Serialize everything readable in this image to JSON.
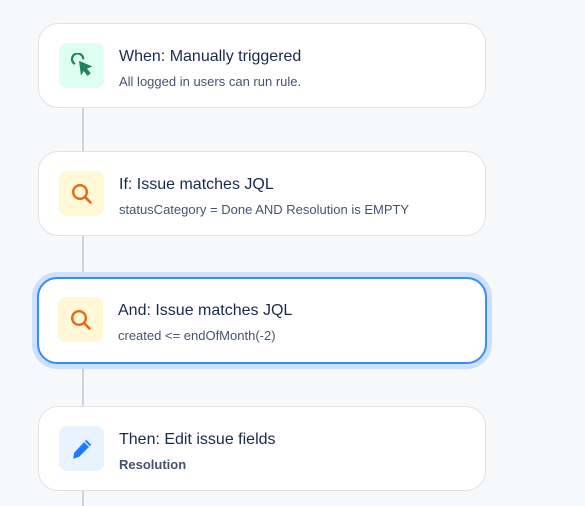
{
  "rule_steps": [
    {
      "title": "When: Manually triggered",
      "subtitle": "All logged in users can run rule.",
      "icon": "cursor-click-icon",
      "icon_color": "#1f845a"
    },
    {
      "title": "If: Issue matches JQL",
      "subtitle": "statusCategory = Done AND Resolution is EMPTY",
      "icon": "search-icon",
      "icon_color": "#e56910"
    },
    {
      "title": "And: Issue matches JQL",
      "subtitle": "created <= endOfMonth(-2)",
      "icon": "search-icon",
      "icon_color": "#e56910",
      "selected": true
    },
    {
      "title": "Then: Edit issue fields",
      "subtitle": "Resolution",
      "icon": "pencil-icon",
      "icon_color": "#1d7afc"
    }
  ],
  "colors": {
    "selected_border": "#388bff",
    "trigger_bg": "#dcfff1",
    "condition_bg": "#fff7d6",
    "action_bg": "#e9f2ff"
  }
}
